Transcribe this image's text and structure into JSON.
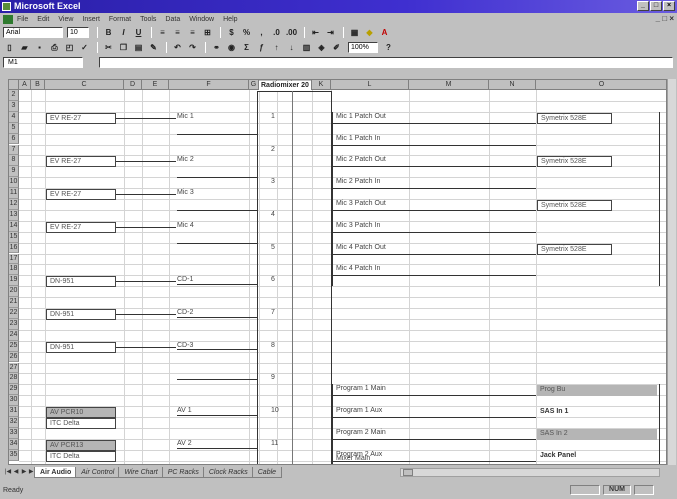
{
  "window": {
    "title": "Microsoft Excel"
  },
  "menu": [
    "File",
    "Edit",
    "View",
    "Insert",
    "Format",
    "Tools",
    "Data",
    "Window",
    "Help"
  ],
  "formatting": {
    "font": "Arial",
    "size": "10"
  },
  "standard": {
    "zoom": "100%"
  },
  "namebox": "M1",
  "columns": [
    "A",
    "B",
    "C",
    "D",
    "E",
    "F",
    "G",
    "H",
    "I",
    "J",
    "K",
    "L",
    "M",
    "N",
    "O"
  ],
  "rows": [
    "2",
    "3",
    "4",
    "5",
    "6",
    "7",
    "8",
    "9",
    "10",
    "11",
    "12",
    "13",
    "14",
    "15",
    "16",
    "17",
    "18",
    "19",
    "20",
    "21",
    "22",
    "23",
    "24",
    "25",
    "26",
    "27",
    "28",
    "29",
    "30",
    "31",
    "32",
    "33",
    "34",
    "35"
  ],
  "header": "Radiomixer 20",
  "sources": [
    "EV RE-27",
    "EV RE-27",
    "EV RE-27",
    "EV RE-27",
    "DN-951",
    "DN-951",
    "DN-951"
  ],
  "av_sources": [
    {
      "label": "AV PCR10",
      "sub": "ITC Delta"
    },
    {
      "label": "AV PCR13",
      "sub": "ITC Delta"
    }
  ],
  "channels": [
    "Mic 1",
    "Mic 2",
    "Mic 3",
    "Mic 4",
    "CD-1",
    "CD-2",
    "CD-3",
    "AV 1",
    "AV 2"
  ],
  "mixer_numbers": [
    "1",
    "2",
    "3",
    "4",
    "5",
    "6",
    "7",
    "8",
    "9",
    "10",
    "11"
  ],
  "patch": [
    "Mic 1 Patch Out",
    "Mic 1 Patch In",
    "Mic 2 Patch Out",
    "Mic 2 Patch In",
    "Mic 3 Patch Out",
    "Mic 3 Patch In",
    "Mic 4 Patch Out",
    "Mic 4 Patch In",
    "Program 1 Main",
    "Program 1 Aux",
    "Program 2 Main",
    "Program 2 Aux",
    "Mixer Main"
  ],
  "destinations": [
    "Symetrix 528E",
    "Symetrix 528E",
    "Symetrix 528E",
    "Symetrix 528E",
    "Prog Bu",
    "SAS In 1",
    "SAS In 2",
    "Jack Panel"
  ],
  "tabs": [
    "Air Audio",
    "Air Control",
    "Wire Chart",
    "PC Racks",
    "Clock Racks",
    "Cable"
  ],
  "status": {
    "ready": "Ready",
    "num": "NUM"
  }
}
